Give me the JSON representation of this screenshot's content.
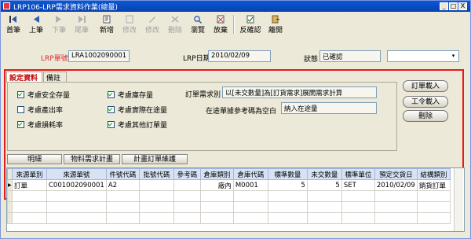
{
  "window": {
    "title": "LRP106-LRP需求資料作業(總量)",
    "controls": [
      "_",
      "□",
      "X"
    ]
  },
  "toolbar": [
    {
      "label": "首筆",
      "icon": "first-record-icon",
      "enabled": true
    },
    {
      "label": "上筆",
      "icon": "previous-record-icon",
      "enabled": true
    },
    {
      "label": "下筆",
      "icon": "next-record-icon",
      "enabled": false
    },
    {
      "label": "尾筆",
      "icon": "last-record-icon",
      "enabled": false
    },
    {
      "label": "新增",
      "icon": "add-icon",
      "enabled": true
    },
    {
      "label": "修改",
      "icon": "edit-icon",
      "enabled": false
    },
    {
      "label": "修改",
      "icon": "modify-icon",
      "enabled": false
    },
    {
      "label": "刪除",
      "icon": "delete-icon",
      "enabled": false
    },
    {
      "label": "瀏覽",
      "icon": "browse-icon",
      "enabled": true
    },
    {
      "label": "放棄",
      "icon": "discard-icon",
      "enabled": true
    },
    {
      "label": "反確認",
      "icon": "unconfirm-icon",
      "enabled": true
    },
    {
      "label": "離開",
      "icon": "exit-icon",
      "enabled": true
    }
  ],
  "header": {
    "lrp_no_label": "LRP單號",
    "lrp_no_value": "LRA1002090001",
    "lrp_date_label": "LRP日期",
    "lrp_date_value": "2010/02/09",
    "status_label": "狀態",
    "status_value": "已確認",
    "extra_select_value": ""
  },
  "tabs": [
    {
      "label": "設定資料",
      "active": true
    },
    {
      "label": "備註",
      "active": false
    }
  ],
  "settings": {
    "checkboxes": [
      {
        "label": "考慮安全存量",
        "checked": true
      },
      {
        "label": "考慮產出率",
        "checked": false
      },
      {
        "label": "考慮損耗率",
        "checked": true
      },
      {
        "label": "考慮庫存量",
        "checked": true
      },
      {
        "label": "考慮實際在途量",
        "checked": true
      },
      {
        "label": "考慮其他訂單量",
        "checked": true
      }
    ],
    "order_demand_label": "訂單需求別",
    "order_demand_value": "以[未交數量]為[訂貨需求]展開需求計算",
    "transit_label": "在途單據參考碼為空白",
    "transit_value": "納入在途量"
  },
  "side_buttons": [
    "訂單載入",
    "工令載入",
    "刪除"
  ],
  "subtabs": [
    "明細",
    "物料需求計畫",
    "計畫訂單維護"
  ],
  "grid": {
    "columns": [
      "來源單別",
      "來源單號",
      "件號代碼",
      "批號代碼",
      "參考碼",
      "倉庫類別",
      "倉庫代碼",
      "標準數量",
      "未交數量",
      "標準單位",
      "預定交貨日",
      "結構類別"
    ],
    "rows": [
      [
        "訂單",
        "C001002090001",
        "A2",
        "",
        "",
        "廠內",
        "M0001",
        "5",
        "5",
        "SET",
        "2010/02/09",
        "銷貨訂單"
      ]
    ]
  },
  "colors": {
    "highlight": "#e41b1b",
    "titlebar": "#0a58d6",
    "label_red": "#d03030"
  }
}
